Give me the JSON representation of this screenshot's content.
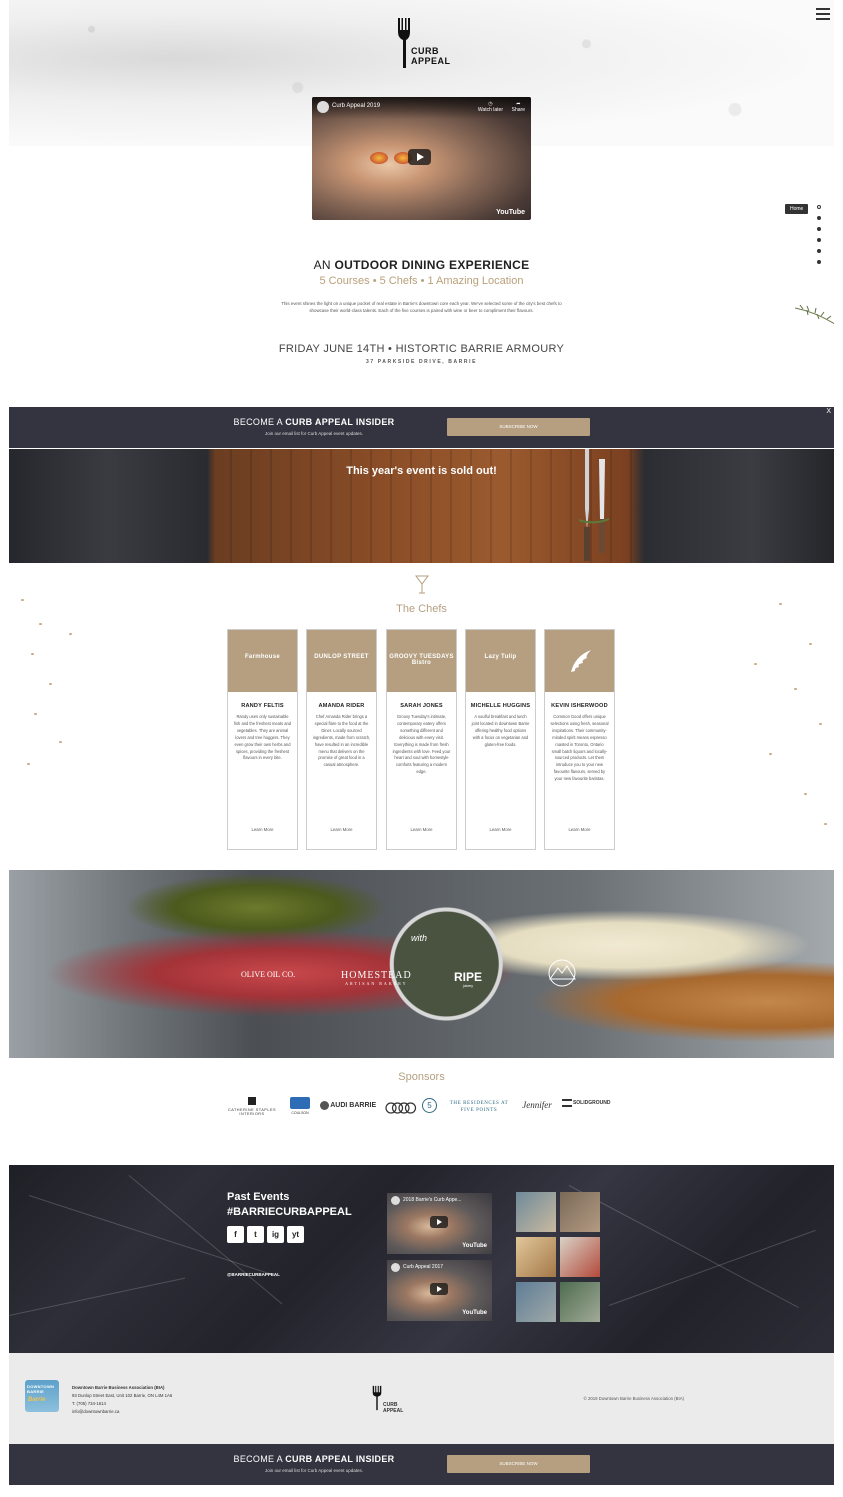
{
  "header": {
    "logo_text": "CURB APPEAL",
    "menu_icon": "hamburger-menu-icon"
  },
  "video": {
    "title": "Curb Appeal 2019",
    "watch_later": "Watch later",
    "share": "Share",
    "brand": "YouTube"
  },
  "side_nav": {
    "home_label": "Home",
    "dot_count_visible": 6
  },
  "intro": {
    "heading_prefix": "AN",
    "heading_strong": "OUTDOOR DINING EXPERIENCE",
    "subheading": "5 Courses • 5 Chefs • 1 Amazing Location",
    "body": "This event shines the light on a unique pocket of real estate in Barrie's downtown core each year. We've selected some of the city's best chefs to showcase their world-class talents. Each of the five courses is paired with wine or beer to compliment their flavours.",
    "date_location": "FRIDAY JUNE 14TH • HISTORTIC BARRIE ARMOURY",
    "address": "37 PARKSIDE DRIVE, BARRIE"
  },
  "insider": {
    "title_prefix": "BECOME A",
    "title_strong": "CURB APPEAL INSIDER",
    "subtitle": "Join our email list for Curb Appeal event updates.",
    "button": "SUBSCRIBE NOW",
    "close": "X"
  },
  "soldout": {
    "text": "This year's event is sold out!"
  },
  "chefs": {
    "title": "The Chefs",
    "items": [
      {
        "logo": "Farmhouse",
        "name": "RANDY FELTIS",
        "desc": "Randy uses only sustainable fish and the freshest meats and vegetables. They are animal lovers and tree huggers. They even grow their own herbs and spices, providing the freshest flavours in every bite.",
        "link": "Learn More"
      },
      {
        "logo": "DUNLOP STREET",
        "name": "AMANDA RIDER",
        "desc": "Chef Amanda Rider brings a special flare to the food at the Diner. Locally sourced ingredients, made from scratch, have resulted in an incredible menu that delivers on the promise of great food in a casual atmosphere.",
        "link": "Learn More"
      },
      {
        "logo": "GROOVY TUESDAYS Bistro",
        "name": "SARAH JONES",
        "desc": "Groovy Tuesday's intimate, contemporary eatery offers something different and delicious with every visit. Everything is made from fresh ingredients with love. Feed your heart and soul with homestyle comforts featuring a modern edge.",
        "link": "Learn More"
      },
      {
        "logo": "Lazy Tulip",
        "name": "MICHELLE HUGGINS",
        "desc": "A soulful breakfast and lunch joint located in downtown Barrie offering healthy food options with a focus on vegetarian and gluten-free foods.",
        "link": "Learn More"
      },
      {
        "logo": "wing-logo",
        "name": "KEVIN ISHERWOOD",
        "desc": "Common Good offers unique selections using fresh, seasonal inspirations. Their community-minded spirit means espresso roasted in Toronto, Ontario small batch liquors and locally-sourced products. Let them introduce you to your new favourite flavours, served by your new favourite baristas.",
        "link": "Learn More"
      }
    ]
  },
  "food_sponsors": {
    "with": "with",
    "olive": "OLIVE OIL CO.",
    "homestead": "HOMESTEAD",
    "homestead_sub": "ARTISAN BAKERY",
    "ripe": "RIPE",
    "ripe_sub": "juicery"
  },
  "sponsors": {
    "title": "Sponsors",
    "logos": [
      "CATHERINE STAPLES INTERIORS",
      "COULSON",
      "AUDI BARRIE",
      "Audi rings",
      "5",
      "THE RESIDENCES AT FIVE POINTS",
      "Jennifer",
      "SOLIDGROUND"
    ]
  },
  "past_events": {
    "title_line1": "Past Events",
    "title_line2": "#BARRIECURBAPPEAL",
    "handle": "@BARRIECURBAPPEAL",
    "social": [
      "f",
      "t",
      "ig",
      "yt"
    ],
    "videos": [
      {
        "title": "2018 Barrie's Curb Appe...",
        "brand": "YouTube"
      },
      {
        "title": "Curb Appeal 2017",
        "brand": "YouTube"
      }
    ]
  },
  "footer": {
    "bia_logo": "DOWNTOWN BARRIE",
    "bia_script": "Barrie",
    "org": "Downtown Barrie Business Association (BIA)",
    "address": "93 Dunlop Street East, Unit 102 Barrie, ON L4M 1A6",
    "phone": "T. (705) 734-1614",
    "email": "info@downtownbarrie.ca",
    "logo_text": "CURB APPEAL",
    "copyright": "© 2019 Downtown Barrie Business Association (BIA)"
  },
  "colors": {
    "accent": "#b59f80",
    "dark": "#343340"
  }
}
